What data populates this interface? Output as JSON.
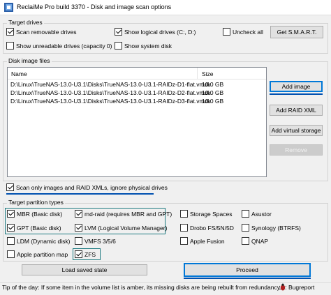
{
  "window": {
    "title": "ReclaiMe Pro build 3370 - Disk and image scan options"
  },
  "target_drives": {
    "label": "Target drives",
    "scan_removable": {
      "label": "Scan removable drives",
      "checked": true
    },
    "show_logical": {
      "label": "Show logical drives (C:, D:)",
      "checked": true
    },
    "uncheck_all": {
      "label": "Uncheck all",
      "checked": false
    },
    "show_unreadable": {
      "label": "Show unreadable drives (capacity 0)",
      "checked": false
    },
    "show_system": {
      "label": "Show system disk",
      "checked": false
    },
    "get_smart_label": "Get S.M.A.R.T."
  },
  "disk_images": {
    "label": "Disk image files",
    "columns": {
      "name": "Name",
      "size": "Size"
    },
    "rows": [
      {
        "path": "D:\\Linux\\TrueNAS-13.0-U3.1\\Disks\\TrueNAS-13.0-U3.1-RAIDz-D1-flat.vmdk",
        "size": "10.0 GB"
      },
      {
        "path": "D:\\Linux\\TrueNAS-13.0-U3.1\\Disks\\TrueNAS-13.0-U3.1-RAIDz-D2-flat.vmdk",
        "size": "10.0 GB"
      },
      {
        "path": "D:\\Linux\\TrueNAS-13.0-U3.1\\Disks\\TrueNAS-13.0-U3.1-RAIDz-D3-flat.vmdk",
        "size": "10.0 GB"
      }
    ],
    "add_image_label": "Add image",
    "add_raid_xml_label": "Add RAID XML",
    "add_virtual_storage_label": "Add virtual storage",
    "remove_label": "Remove"
  },
  "scan_only_images": {
    "label": "Scan only images and RAID XMLs, ignore physical drives",
    "checked": true
  },
  "partition_types": {
    "label": "Target partition types",
    "mbr": {
      "label": "MBR (Basic disk)",
      "checked": true
    },
    "md_raid": {
      "label": "md-raid (requires MBR and GPT)",
      "checked": true
    },
    "storage_spaces": {
      "label": "Storage Spaces",
      "checked": false
    },
    "asustor": {
      "label": "Asustor",
      "checked": false
    },
    "gpt": {
      "label": "GPT (Basic disk)",
      "checked": true
    },
    "lvm": {
      "label": "LVM (Logical Volume Manager)",
      "checked": true
    },
    "drobo": {
      "label": "Drobo FS/5N/5D",
      "checked": false
    },
    "synology": {
      "label": "Synology (BTRFS)",
      "checked": false
    },
    "ldm": {
      "label": "LDM (Dynamic disk)",
      "checked": false
    },
    "vmfs": {
      "label": "VMFS 3/5/6",
      "checked": false
    },
    "apple_fusion": {
      "label": "Apple Fusion",
      "checked": false
    },
    "qnap": {
      "label": "QNAP",
      "checked": false
    },
    "apple_partition_map": {
      "label": "Apple partition map",
      "checked": false
    },
    "zfs": {
      "label": "ZFS",
      "checked": true
    }
  },
  "buttons": {
    "load_saved_state": "Load saved state",
    "proceed": "Proceed"
  },
  "status": {
    "tip": "Tip of the day: If some item in the volume list is amber, its missing disks are being rebuilt from redundancy.",
    "bugreport": "Bugreport"
  },
  "colors": {
    "highlight": "#1c7a80",
    "focus": "#0078d7",
    "underline": "#0050b0"
  }
}
